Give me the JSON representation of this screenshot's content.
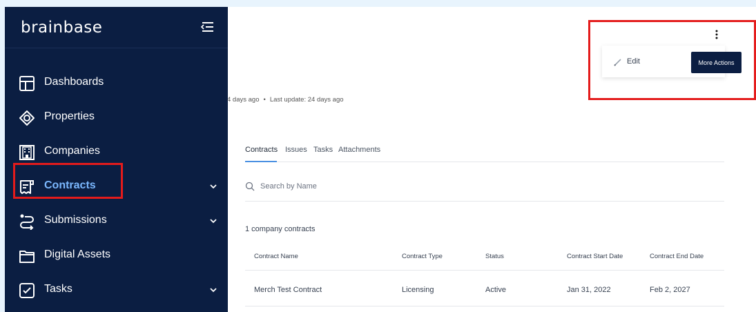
{
  "colors": {
    "sidebar_bg": "#0b1e42",
    "active_nav": "#7bb8ff",
    "highlight": "#e41b1b",
    "tab_accent": "#4a90e2",
    "page_bg": "#e8f4fd"
  },
  "sidebar": {
    "brand": "brainbase",
    "collapse_icon": "collapse-menu-icon",
    "items": [
      {
        "label": "Dashboards",
        "icon": "dashboard-icon",
        "active": false,
        "has_chevron": false
      },
      {
        "label": "Properties",
        "icon": "properties-icon",
        "active": false,
        "has_chevron": false
      },
      {
        "label": "Companies",
        "icon": "building-icon",
        "active": false,
        "has_chevron": false
      },
      {
        "label": "Contracts",
        "icon": "contract-icon",
        "active": true,
        "has_chevron": true
      },
      {
        "label": "Submissions",
        "icon": "submissions-icon",
        "active": false,
        "has_chevron": true
      },
      {
        "label": "Digital Assets",
        "icon": "folder-icon",
        "active": false,
        "has_chevron": false
      },
      {
        "label": "Tasks",
        "icon": "checkbox-icon",
        "active": false,
        "has_chevron": true
      }
    ]
  },
  "header": {
    "created": "4 days ago",
    "separator": "•",
    "last_update_label": "Last update:",
    "last_update_value": "24 days ago"
  },
  "actions": {
    "kebab_icon": "kebab-menu-icon",
    "edit_label": "Edit",
    "more_label": "More Actions"
  },
  "tabs": [
    "Contracts",
    "Issues",
    "Tasks",
    "Attachments"
  ],
  "active_tab": "Contracts",
  "search": {
    "placeholder": "Search by Name",
    "value": ""
  },
  "summary": "1 company contracts",
  "table": {
    "columns": [
      "Contract Name",
      "Contract Type",
      "Status",
      "Contract Start Date",
      "Contract End Date"
    ],
    "rows": [
      [
        "Merch Test Contract",
        "Licensing",
        "Active",
        "Jan 31, 2022",
        "Feb 2, 2027"
      ]
    ]
  }
}
